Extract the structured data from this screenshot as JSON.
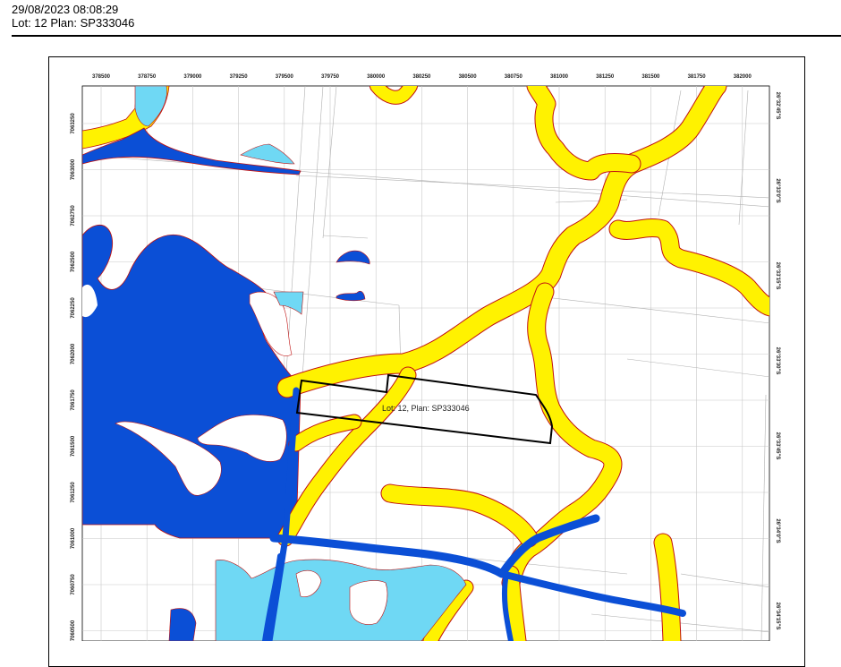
{
  "header": {
    "datetime": "29/08/2023 08:08:29",
    "lot_plan": "Lot: 12 Plan: SP333046"
  },
  "map": {
    "lot_label": "Lot: 12, Plan: SP333046",
    "x_ticks": [
      "378500",
      "378750",
      "379000",
      "379250",
      "379500",
      "379750",
      "380000",
      "380250",
      "380500",
      "380750",
      "381000",
      "381250",
      "381500",
      "381750",
      "382000"
    ],
    "y_ticks": [
      "7063250",
      "7063000",
      "7062750",
      "7062500",
      "7062250",
      "7062000",
      "7061750",
      "7061500",
      "7061250",
      "7061000",
      "7060750",
      "7060500"
    ],
    "lat_ticks": [
      "26°32'45\"S",
      "26°33'0\"S",
      "26°33'15\"S",
      "26°33'30\"S",
      "26°33'45\"S",
      "26°34'0\"S",
      "26°34'15\"S"
    ],
    "colors": {
      "water_dark": "#0b4fd6",
      "water_light": "#6fd8f4",
      "yellow": "#fff200",
      "outline": "#c01010",
      "grid": "#c8c8c8",
      "boundary": "#000000"
    }
  }
}
